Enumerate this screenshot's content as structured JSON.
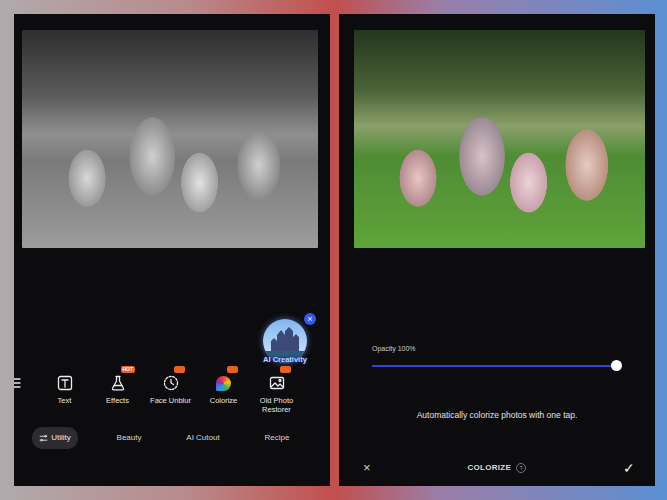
{
  "left_screen": {
    "photo": {
      "colorized": false
    },
    "ai_creativity": {
      "label": "AI Creativity",
      "close": "×"
    },
    "tools": [
      {
        "label": "Text",
        "badge": false
      },
      {
        "label": "Effects",
        "badge": true,
        "badge_text": "HOT"
      },
      {
        "label": "Face Unblur",
        "badge": true
      },
      {
        "label": "Colorize",
        "badge": true
      },
      {
        "label": "Old Photo Restorer",
        "badge": true
      }
    ],
    "categories": [
      {
        "label": "Utility",
        "selected": true
      },
      {
        "label": "Beauty",
        "selected": false
      },
      {
        "label": "AI Cutout",
        "selected": false
      },
      {
        "label": "Recipe",
        "selected": false
      }
    ]
  },
  "right_screen": {
    "photo": {
      "colorized": true
    },
    "opacity": {
      "label": "Opacity 100%",
      "level": 1
    },
    "hint": "Automatically colorize photos with one tap.",
    "toolbar": {
      "cancel": "×",
      "title": "COLORIZE",
      "help": "?",
      "confirm": "✓"
    }
  }
}
